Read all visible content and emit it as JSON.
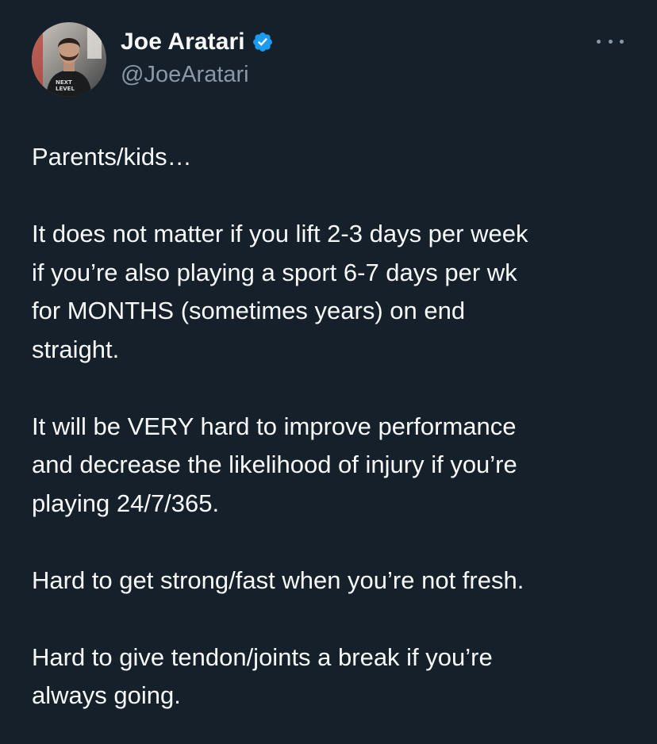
{
  "author": {
    "display_name": "Joe Aratari",
    "handle": "@JoeAratari",
    "verified_icon": "verified-badge-icon",
    "avatar_icon": "avatar"
  },
  "menu": {
    "icon": "more-options-icon"
  },
  "tweet": {
    "paragraphs": [
      "Parents/kids…",
      "It does not matter if you lift 2-3 days per week\nif you’re also playing a sport 6-7 days per wk\nfor MONTHS (sometimes years) on end\nstraight.",
      "It will be VERY hard to improve performance\nand decrease the likelihood of injury if you’re\nplaying 24/7/365.",
      "Hard to get strong/fast when you’re not fresh.",
      "Hard to give tendon/joints a break if you’re\nalways going."
    ]
  },
  "colors": {
    "background": "#15202b",
    "text_primary": "#f7f9f9",
    "text_secondary": "#8b98a5",
    "verified": "#1d9bf0"
  }
}
